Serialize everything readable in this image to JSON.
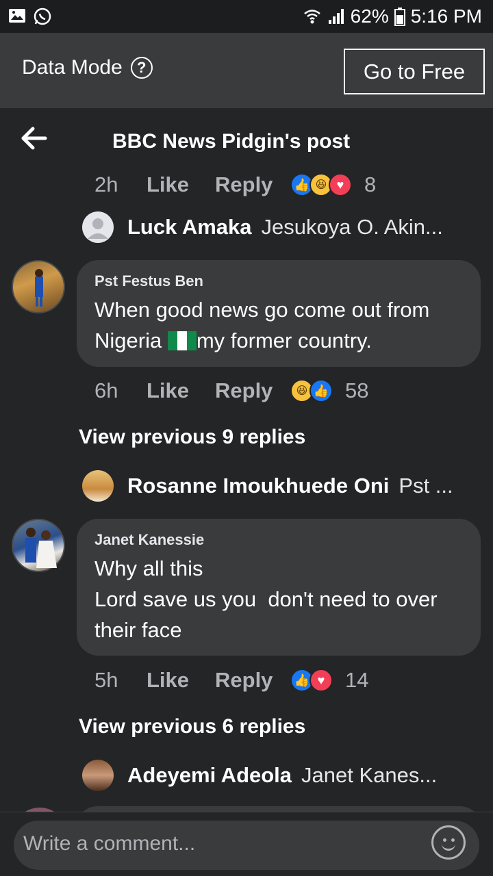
{
  "status_bar": {
    "battery": "62%",
    "time": "5:16 PM"
  },
  "data_mode": {
    "label": "Data Mode",
    "help": "?",
    "button": "Go to Free"
  },
  "header": {
    "title": "BBC News Pidgin's post"
  },
  "comments": [
    {
      "meta": {
        "time": "2h",
        "like": "Like",
        "reply": "Reply",
        "count": "8"
      },
      "reactions": [
        "like",
        "haha",
        "love"
      ],
      "reply_preview": {
        "name": "Luck Amaka",
        "snippet": "Jesukoya O. Akin..."
      }
    },
    {
      "author": "Pst Festus Ben",
      "text_line1": "When good news go come out from",
      "text_line2_a": "Nigeria ",
      "text_line2_b": "my former country.",
      "meta": {
        "time": "6h",
        "like": "Like",
        "reply": "Reply",
        "count": "58"
      },
      "reactions": [
        "haha",
        "like"
      ],
      "view_previous": "View previous 9 replies",
      "reply_preview": {
        "name": "Rosanne Imoukhuede Oni",
        "snippet": "Pst ..."
      }
    },
    {
      "author": "Janet Kanessie",
      "text_line1": "Why all this",
      "text_line2": "Lord save us you  don't need to over",
      "text_line3": "their face",
      "meta": {
        "time": "5h",
        "like": "Like",
        "reply": "Reply",
        "count": "14"
      },
      "reactions": [
        "like",
        "love"
      ],
      "view_previous": "View previous 6 replies",
      "reply_preview": {
        "name": "Adeyemi Adeola",
        "snippet": "Janet Kanes..."
      }
    }
  ],
  "composer": {
    "placeholder": "Write a comment..."
  },
  "colors": {
    "background": "#242526",
    "bubble": "#3a3b3c",
    "like_blue": "#1877f2",
    "love_red": "#f33e58",
    "haha_yellow": "#f7c23e"
  }
}
